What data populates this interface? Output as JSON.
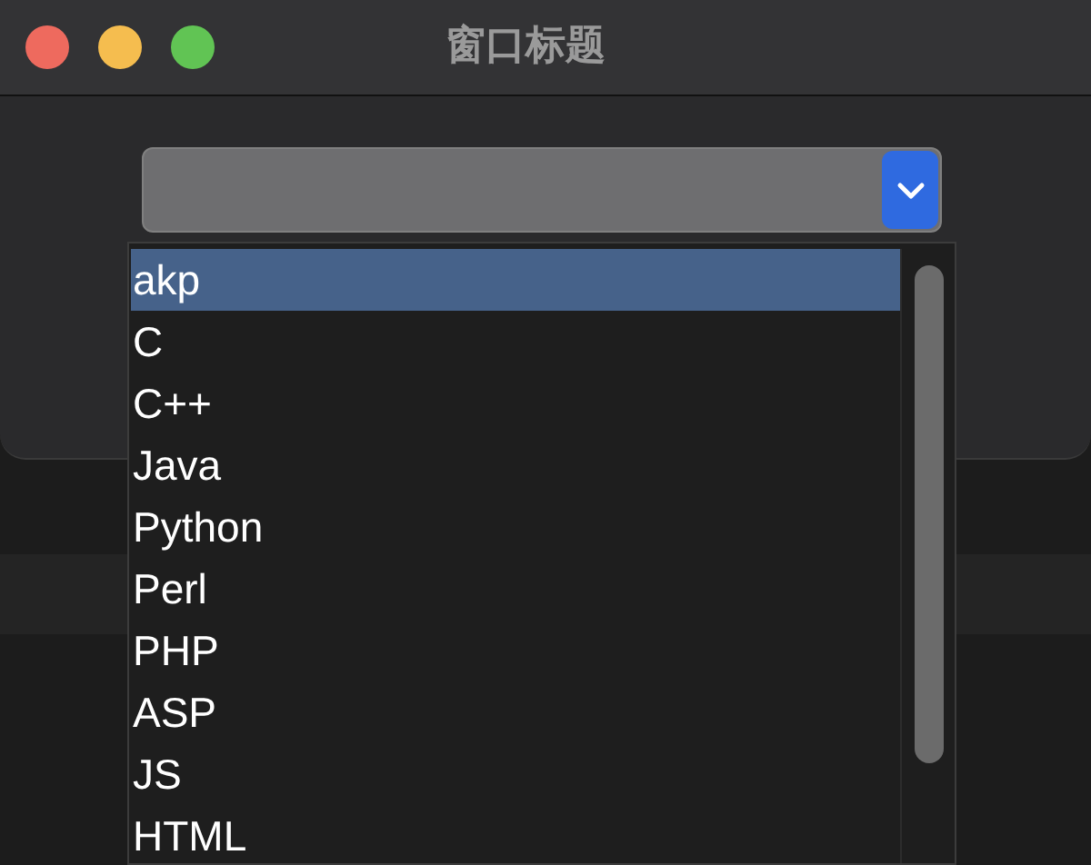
{
  "window": {
    "title": "窗口标题"
  },
  "dropdown": {
    "items": [
      {
        "label": "akp",
        "selected": true
      },
      {
        "label": "C",
        "selected": false
      },
      {
        "label": "C++",
        "selected": false
      },
      {
        "label": "Java",
        "selected": false
      },
      {
        "label": "Python",
        "selected": false
      },
      {
        "label": "Perl",
        "selected": false
      },
      {
        "label": "PHP",
        "selected": false
      },
      {
        "label": "ASP",
        "selected": false
      },
      {
        "label": "JS",
        "selected": false
      },
      {
        "label": "HTML",
        "selected": false
      }
    ]
  }
}
